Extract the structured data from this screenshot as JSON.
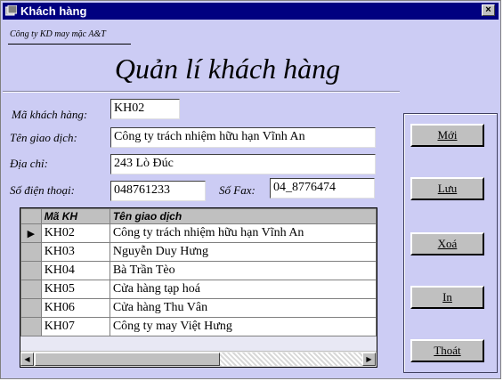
{
  "window": {
    "title": "Khách hàng",
    "close_label": "×"
  },
  "company": "Công ty KD may mặc A&T",
  "heading": "Quản lí khách hàng",
  "form": {
    "customer_id": {
      "label": "Mã khách hàng:",
      "value": "KH02"
    },
    "trade_name": {
      "label": "Tên giao dịch:",
      "value": "Công ty trách nhiệm hữu hạn Vĩnh An"
    },
    "address": {
      "label": "Địa chỉ:",
      "value": "243 Lò Đúc"
    },
    "phone": {
      "label": "Số điện thoại:",
      "value": "048761233"
    },
    "fax": {
      "label": "Số Fax:",
      "value": "04_8776474"
    }
  },
  "grid": {
    "columns": [
      "Mã KH",
      "Tên giao dịch"
    ],
    "current_row_marker": "▶",
    "rows": [
      [
        "KH02",
        "Công ty trách nhiệm hữu hạn Vĩnh An"
      ],
      [
        "KH03",
        "Nguyễn Duy Hưng"
      ],
      [
        "KH04",
        "Bà Trần Tèo"
      ],
      [
        "KH05",
        "Cửa hàng tạp hoá"
      ],
      [
        "KH06",
        "Cửa hàng Thu Vân"
      ],
      [
        "KH07",
        "Công ty may Việt Hưng"
      ]
    ],
    "scroll_left": "◀",
    "scroll_right": "▶"
  },
  "buttons": {
    "new": "Mới",
    "save": "Lưu",
    "delete": "Xoá",
    "print": "In",
    "exit": "Thoát"
  }
}
